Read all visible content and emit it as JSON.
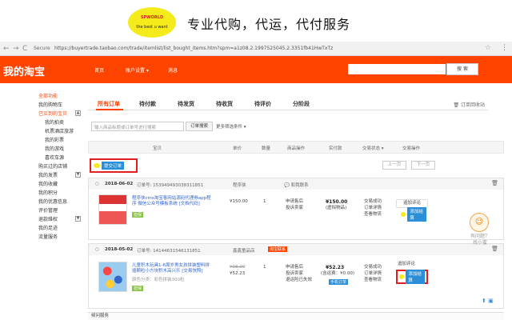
{
  "banner": {
    "logo_top": "SPWORLD",
    "logo_bottom": "the best u want",
    "tagline": "专业代购，代运，代付服务"
  },
  "browser": {
    "back": "←",
    "forward": "→",
    "reload": "C",
    "secure": "Secure",
    "url": "https://buyertrade.taobao.com/trade/itemlist/list_bought_items.htm?spm=a1z08.2.1997525045.2.3351fb41HwTxTz"
  },
  "topbar": {
    "logo": "我的淘宝",
    "nav": [
      "首页",
      "账户设置 ▾",
      "消息"
    ],
    "search_btn": "搜 索"
  },
  "sidebar": {
    "items": [
      {
        "label": "全部功能",
        "style": "red"
      },
      {
        "label": "我的购物车",
        "style": ""
      },
      {
        "label": "已买到的宝贝",
        "style": "red",
        "box": "▲"
      },
      {
        "label": "我的拍卖",
        "style": "sub"
      },
      {
        "label": "机票酒店旅游",
        "style": "sub"
      },
      {
        "label": "我的彩票",
        "style": "sub"
      },
      {
        "label": "我的游戏",
        "style": "sub"
      },
      {
        "label": "喜欢车源",
        "style": "sub"
      },
      {
        "label": "购买过的店铺",
        "style": ""
      },
      {
        "label": "我的发票",
        "style": "",
        "box": "▼"
      },
      {
        "label": "我的收藏",
        "style": ""
      },
      {
        "label": "我的积分",
        "style": ""
      },
      {
        "label": "我的优惠信息",
        "style": ""
      },
      {
        "label": "评价管理",
        "style": ""
      },
      {
        "label": "退款维权",
        "style": "",
        "box": "▼"
      },
      {
        "label": "我的足迹",
        "style": ""
      },
      {
        "label": "流量服务",
        "style": ""
      }
    ]
  },
  "tabs": {
    "items": [
      "所有订单",
      "待付款",
      "待发货",
      "待收货",
      "待评价",
      "分阶段"
    ],
    "recycle": "订单回收站"
  },
  "search": {
    "placeholder": "输入商品标题或订单号进行搜索",
    "button": "订单搜索",
    "more": "更多筛选条件 ▾"
  },
  "table": {
    "headers": [
      "宝贝",
      "单价",
      "数量",
      "商品操作",
      "实付款",
      "交易状态 ▾",
      "交易操作"
    ],
    "merge_btn": "提交订单",
    "prev": "上一页",
    "next": "下一页"
  },
  "orders": [
    {
      "date": "2018-06-02",
      "order_no": "订单号: 153949493038311851",
      "shop": "程序侠",
      "title": "程序侠cms淘宝客网站源码代理券app程序 微信公众号模板系统 [文档代码]",
      "badge": "担保",
      "unit_price": "¥150.00",
      "qty": "1",
      "ops": [
        "申请售后",
        "投诉卖家"
      ],
      "paid": "¥150.00",
      "paid_note": "(虚拟物品)",
      "status": [
        "交易成功",
        "订单详情",
        "查看物流"
      ],
      "action": "追加评论",
      "pay_btn": "添加结算"
    },
    {
      "date": "2018-05-02",
      "order_no": "订单号: 14144631546131851",
      "shop": "鑫鑫童品店",
      "shop_badge": "淘宝联系",
      "title": "儿童积木玩具1-6周岁男女孩拼装塑料拼插颗粒小方块积木高兴乐 [交易快照]",
      "subnote": "颜色分类：彩色拼装300粒",
      "badge": "担保",
      "original_price": "¥98.00",
      "unit_price": "¥52.23",
      "qty": "1",
      "ops": [
        "申请售后",
        "投诉卖家",
        "退运险已失效"
      ],
      "paid": "¥52.23",
      "paid_note": "(含运费：¥0.00)",
      "paid_note2": "手机订单",
      "status": [
        "交易成功",
        "订单详情",
        "查看物流"
      ],
      "action": "追加评论",
      "pay_btn": "添加结算"
    }
  ],
  "help": {
    "mascot": "☺",
    "line1": "有问题？",
    "line2": "找小蜜"
  },
  "bottom": {
    "item": "候问服务"
  },
  "colors": {
    "taobao_orange": "#ff4400",
    "highlight_red": "#e02020",
    "logo_yellow": "#f5ea1a",
    "link_blue": "#3366cc"
  }
}
